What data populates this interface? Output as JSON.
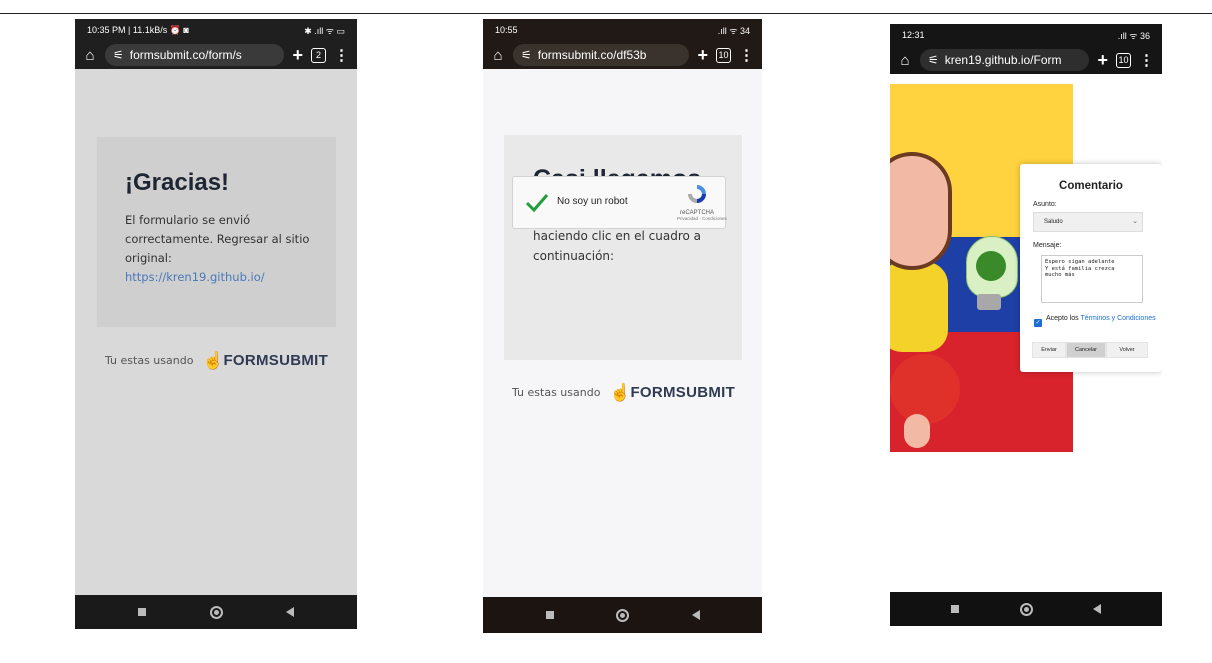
{
  "phones": [
    {
      "status": {
        "time": "10:35 PM | 11.1kB/s ⏰ ◙",
        "right": "✱ .ıll ᯤ ▭"
      },
      "url": "formsubmit.co/form/s",
      "tab_count": "2",
      "card": {
        "title": "¡Gracias!",
        "message": "El formulario se envió correctamente. Regresar al sitio original:",
        "link": "https://kren19.github.io/"
      },
      "footer": {
        "prefix": "Tu estas usando",
        "brand": "FORMSUBMIT"
      }
    },
    {
      "status": {
        "time": "10:55",
        "right": ".ıll ᯤ 34"
      },
      "url": "formsubmit.co/df53b",
      "tab_count": "10",
      "card": {
        "title": "Casi llegamos",
        "message": "Ayúdenos a combatir el spam haciendo clic en el cuadro a continuación:"
      },
      "captcha": {
        "label": "No soy un robot",
        "brand": "reCAPTCHA",
        "links": "Privacidad - Condiciones"
      },
      "footer": {
        "prefix": "Tu estas usando",
        "brand": "FORMSUBMIT"
      }
    },
    {
      "status": {
        "time": "12:31",
        "right": ".ıll ᯤ 36"
      },
      "url": "kren19.github.io/Form",
      "tab_count": "10",
      "form": {
        "title": "Comentario",
        "subject_label": "Asunto:",
        "subject_value": "Saludo",
        "message_label": "Mensaje:",
        "message_value": "Espero sigan adelante\nY está familia crezca\nmucho más",
        "accept_text": "Acepto los ",
        "terms_link": "Términos y Condiciones",
        "buttons": [
          "Enviar",
          "Cancelar",
          "Volver"
        ]
      }
    }
  ],
  "icons": [
    "home-icon",
    "site-info-icon",
    "new-tab-icon",
    "tab-switcher-icon",
    "overflow-menu-icon",
    "checkmark-icon",
    "recaptcha-logo-icon",
    "formsubmit-hand-icon"
  ],
  "colors": {
    "link": "#4a79b8",
    "flag_yellow": "#ffd23f",
    "flag_blue": "#1e3fa6",
    "flag_red": "#d8232c"
  }
}
